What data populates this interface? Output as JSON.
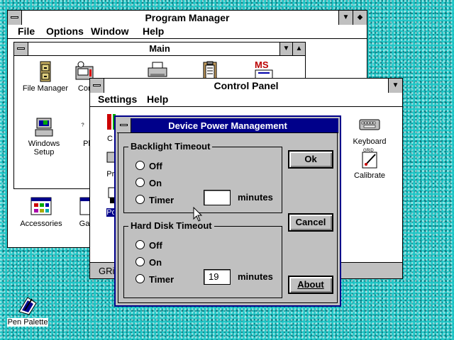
{
  "program_manager": {
    "title": "Program Manager",
    "menus": [
      "File",
      "Options",
      "Window",
      "Help"
    ],
    "groups": [
      {
        "label": "Accessories",
        "icon": "accessories-group-icon"
      },
      {
        "label": "Ga",
        "icon": "games-group-icon"
      }
    ]
  },
  "main_group": {
    "title": "Main",
    "icons": [
      {
        "label": "File Manager",
        "icon": "file-cabinet-icon"
      },
      {
        "label": "Con",
        "icon": "control-panel-icon"
      },
      {
        "label": "",
        "icon": "printer-icon"
      },
      {
        "label": "",
        "icon": "clipboard-icon"
      },
      {
        "label": "",
        "icon": "ms-dos-icon"
      },
      {
        "label": "Windows Setup",
        "icon": "windows-setup-icon"
      },
      {
        "label": "Pl",
        "icon": "pif-editor-icon"
      }
    ],
    "ms_label": "MS"
  },
  "control_panel": {
    "title": "Control Panel",
    "menus": [
      "Settings",
      "Help"
    ],
    "icons": [
      {
        "label": "Keyboard",
        "icon": "keyboard-icon"
      },
      {
        "label": "Calibrate",
        "icon": "calibrate-pen-icon"
      },
      {
        "label": "Pri",
        "icon": "printers-icon"
      },
      {
        "label": "Po",
        "icon": "power-icon"
      },
      {
        "label": "C",
        "icon": "color-icon"
      }
    ],
    "calibrate_badge": "GRiD",
    "status_text": "GRi"
  },
  "dialog": {
    "title": "Device Power Management",
    "backlight": {
      "label": "Backlight Timeout",
      "options": [
        "Off",
        "On",
        "Timer"
      ],
      "timer_value": "",
      "unit": "minutes"
    },
    "harddisk": {
      "label": "Hard Disk Timeout",
      "options": [
        "Off",
        "On",
        "Timer"
      ],
      "timer_value": "19",
      "unit": "minutes"
    },
    "buttons": {
      "ok": "Ok",
      "cancel": "Cancel",
      "about": "About"
    }
  },
  "desktop": {
    "icons": [
      {
        "label": "Pen Palette",
        "icon": "pen-palette-icon"
      }
    ]
  },
  "colors": {
    "desktop": "#1fc6c6",
    "active_title": "#00008a",
    "dialog_face": "#c0c0c0",
    "selection": "#00008a"
  }
}
